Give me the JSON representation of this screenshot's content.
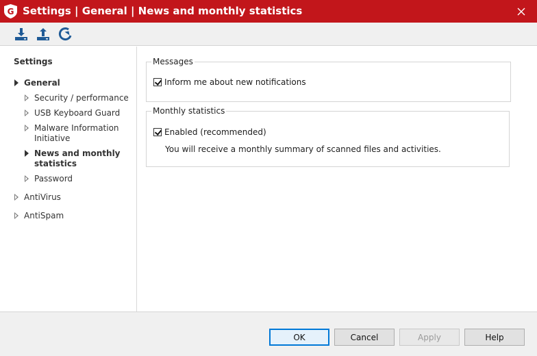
{
  "window": {
    "title": "Settings | General | News and monthly statistics",
    "close_label": "×",
    "accent_color": "#c2161b"
  },
  "toolbar": {
    "buttons": [
      {
        "icon": "download-icon"
      },
      {
        "icon": "upload-icon"
      },
      {
        "icon": "reset-icon"
      }
    ]
  },
  "sidebar": {
    "title": "Settings",
    "items": [
      {
        "label": "General",
        "level": 0,
        "expanded": true
      },
      {
        "label": "Security / performance",
        "level": 1
      },
      {
        "label": "USB Keyboard Guard",
        "level": 1
      },
      {
        "label_line1": "Malware Information",
        "label_line2": "Initiative",
        "level": 1
      },
      {
        "label_line1": "News and monthly",
        "label_line2": "statistics",
        "level": 1,
        "selected": true
      },
      {
        "label": "Password",
        "level": 1
      },
      {
        "label": "AntiVirus",
        "level": 0
      },
      {
        "label": "AntiSpam",
        "level": 0
      }
    ]
  },
  "main": {
    "messages": {
      "legend": "Messages",
      "checkbox_label": "Inform me about new notifications",
      "checked": true
    },
    "monthly": {
      "legend": "Monthly statistics",
      "checkbox_label": "Enabled (recommended)",
      "checked": true,
      "description": "You will receive a monthly summary of scanned files and activities."
    }
  },
  "footer": {
    "ok": "OK",
    "cancel": "Cancel",
    "apply": "Apply",
    "help": "Help"
  }
}
